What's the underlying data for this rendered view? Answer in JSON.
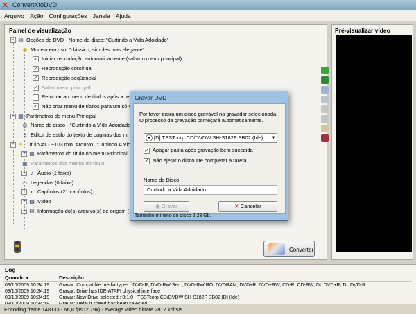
{
  "window": {
    "title": "ConvertXtoDVD"
  },
  "menu": [
    "Arquivo",
    "Ação",
    "Configurações",
    "Janela",
    "Ajuda"
  ],
  "panel": {
    "title": "Painel de visualização",
    "tree": [
      {
        "label": "Opções de DVD - Nome do disco: \"Curtindo a Vida Adoidado\"",
        "icon": "dvd-options-icon",
        "expander": "-"
      },
      {
        "label": "Modelo em uso: \"clássico, simples mas elegante\"",
        "icon": "template-icon"
      },
      {
        "label": "Iniciar reprodução automaticamente (saltar o menu principal)",
        "checked": true
      },
      {
        "label": "Reprodução contínua",
        "checked": true
      },
      {
        "label": "Reprodução seqüencial",
        "checked": true
      },
      {
        "label": "Saltar menu principal",
        "checked": true,
        "disabled": true
      },
      {
        "label": "Retornar ao menu de títulos após a repr",
        "checked": false
      },
      {
        "label": "Não criar menu de títulos para um só víd",
        "checked": true
      },
      {
        "label": "Parâmetros do menu Principal",
        "icon": "menu-params-icon",
        "expander": "+"
      },
      {
        "label": "Nome do disco - \"Curtindo a Vida Adoidado",
        "icon": "disc-icon"
      },
      {
        "label": "Editor de estilo do texto de páginas dos m",
        "icon": "text-style-icon"
      },
      {
        "label": "Título #1 - ~103 min. Arquivo: \"Curtindo A Vid",
        "icon": "title-icon",
        "expander": "-"
      },
      {
        "label": "Parâmetros do título no menu Principal",
        "icon": "menu-params-icon",
        "expander": "+"
      },
      {
        "label": "Parâmetros dos menus do título",
        "icon": "menu-params-icon",
        "disabled": true
      },
      {
        "label": "Áudio (1 faixa)",
        "icon": "audio-icon",
        "expander": "+"
      },
      {
        "label": "Legendas (0 faixa)",
        "icon": "subtitles-icon"
      },
      {
        "label": "Capítulos (21 capítulos)",
        "icon": "chapters-icon",
        "expander": "+"
      },
      {
        "label": "Vídeo",
        "icon": "video-icon",
        "expander": "+"
      },
      {
        "label": "Informação do(s) arquivo(s) de origem (1)",
        "icon": "file-info-icon",
        "expander": "+"
      }
    ]
  },
  "preview": {
    "title": "Pré-visualizar vídeo"
  },
  "convert_button": "Converter",
  "dialog": {
    "title": "Gravar DVD",
    "message": "Por favor insira um disco gravável no gravador selecionada. O processo de gravação começará automaticamente.",
    "drive": "[D] TSSTcorp CD/DVDW SH-S182F SB02 (Ide)",
    "opt_erase": "Apagar pasta após gravação bem sucedida",
    "opt_noeject": "Não ejetar o disco até completar a tarefa",
    "name_label": "Nome do Disco",
    "name_value": "Curtindo a Vida Adoidado",
    "burn_button": "Gravar",
    "cancel_button": "Cancelar",
    "footer": "Tamanho mínimo do disco 2,23 Gb."
  },
  "log": {
    "title": "Log",
    "columns": [
      "Quando",
      "Descrição"
    ],
    "rows": [
      [
        "09/10/2009 10:34:19",
        "Gravar: Compatible media types : DVD-R, DVD-RW Seq., DVD-RW RO, DVDRAM, DVD+R, DVD+RW, CD-R, CD-RW, DL DVD+R, DL DVD-R"
      ],
      [
        "09/10/2009 10:34:19",
        "Gravar: Drive has IDE-ATAPI physical interface"
      ],
      [
        "09/10/2009 10:34:19",
        "Gravar: New Drive selected : 0:1:0 - TSSTcorp CD/DVDW SH-S182F SB02 [D] (Ide)"
      ],
      [
        "09/10/2009 10:34:19",
        "Gravar: Default speed has been selected"
      ]
    ]
  },
  "status": "Encoding frame 148133 - 66,8 fps (2,79x) - average video bitrate 2817 kbits/s",
  "colors": {
    "preview_bg": "#000000",
    "dialog_frame": "#9dc2e4",
    "close_x": "#d01010"
  }
}
